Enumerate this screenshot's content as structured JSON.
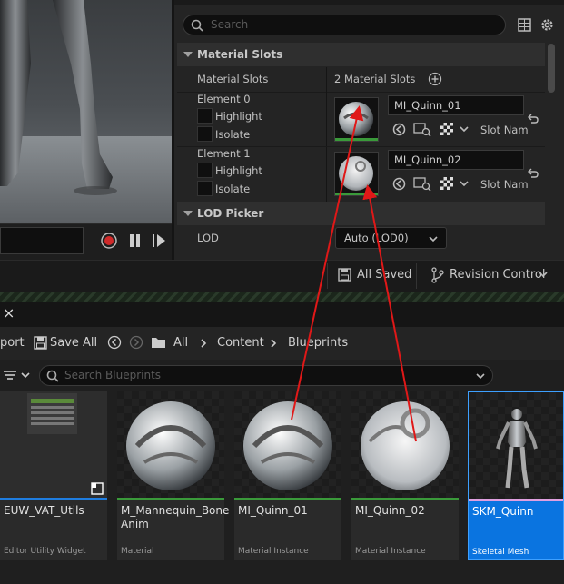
{
  "details": {
    "search_placeholder": "Search",
    "material_slots_section": "Material Slots",
    "material_slots_label": "Material Slots",
    "material_slots_count": "2 Material Slots",
    "elements": [
      {
        "label": "Element 0",
        "highlight": "Highlight",
        "isolate": "Isolate",
        "material": "MI_Quinn_01",
        "slot_name": "Slot Nam"
      },
      {
        "label": "Element 1",
        "highlight": "Highlight",
        "isolate": "Isolate",
        "material": "MI_Quinn_02",
        "slot_name": "Slot Nam"
      }
    ],
    "lod_section": "LOD Picker",
    "lod_label": "LOD",
    "lod_value": "Auto (LOD0)"
  },
  "statusbar": {
    "all_saved": "All Saved",
    "revision_control": "Revision Control"
  },
  "content_browser": {
    "close_tab": "×",
    "import_partial": "port",
    "save_all": "Save All",
    "breadcrumb": [
      "All",
      "Content",
      "Blueprints"
    ],
    "search_placeholder": "Search Blueprints",
    "assets": [
      {
        "name": "EUW_VAT_Utils",
        "type": "Editor Utility Widget",
        "color": "#1f7de0"
      },
      {
        "name": "M_Mannequin_Bone Anim",
        "type": "Material",
        "color": "#3a9a3a"
      },
      {
        "name": "MI_Quinn_01",
        "type": "Material Instance",
        "color": "#3a9a3a"
      },
      {
        "name": "MI_Quinn_02",
        "type": "Material Instance",
        "color": "#3a9a3a"
      },
      {
        "name": "SKM_Quinn",
        "type": "Skeletal Mesh",
        "color": "#e0a0e0"
      }
    ]
  },
  "icons": [
    "search-icon",
    "grid-icon",
    "gear-icon",
    "add-icon",
    "reset-icon",
    "browse-icon",
    "checker-icon",
    "chevron-down-icon",
    "record-icon",
    "pause-icon",
    "play-icon",
    "save-icon",
    "history-back-icon",
    "history-forward-icon",
    "folder-icon",
    "filter-icon",
    "branch-icon"
  ]
}
